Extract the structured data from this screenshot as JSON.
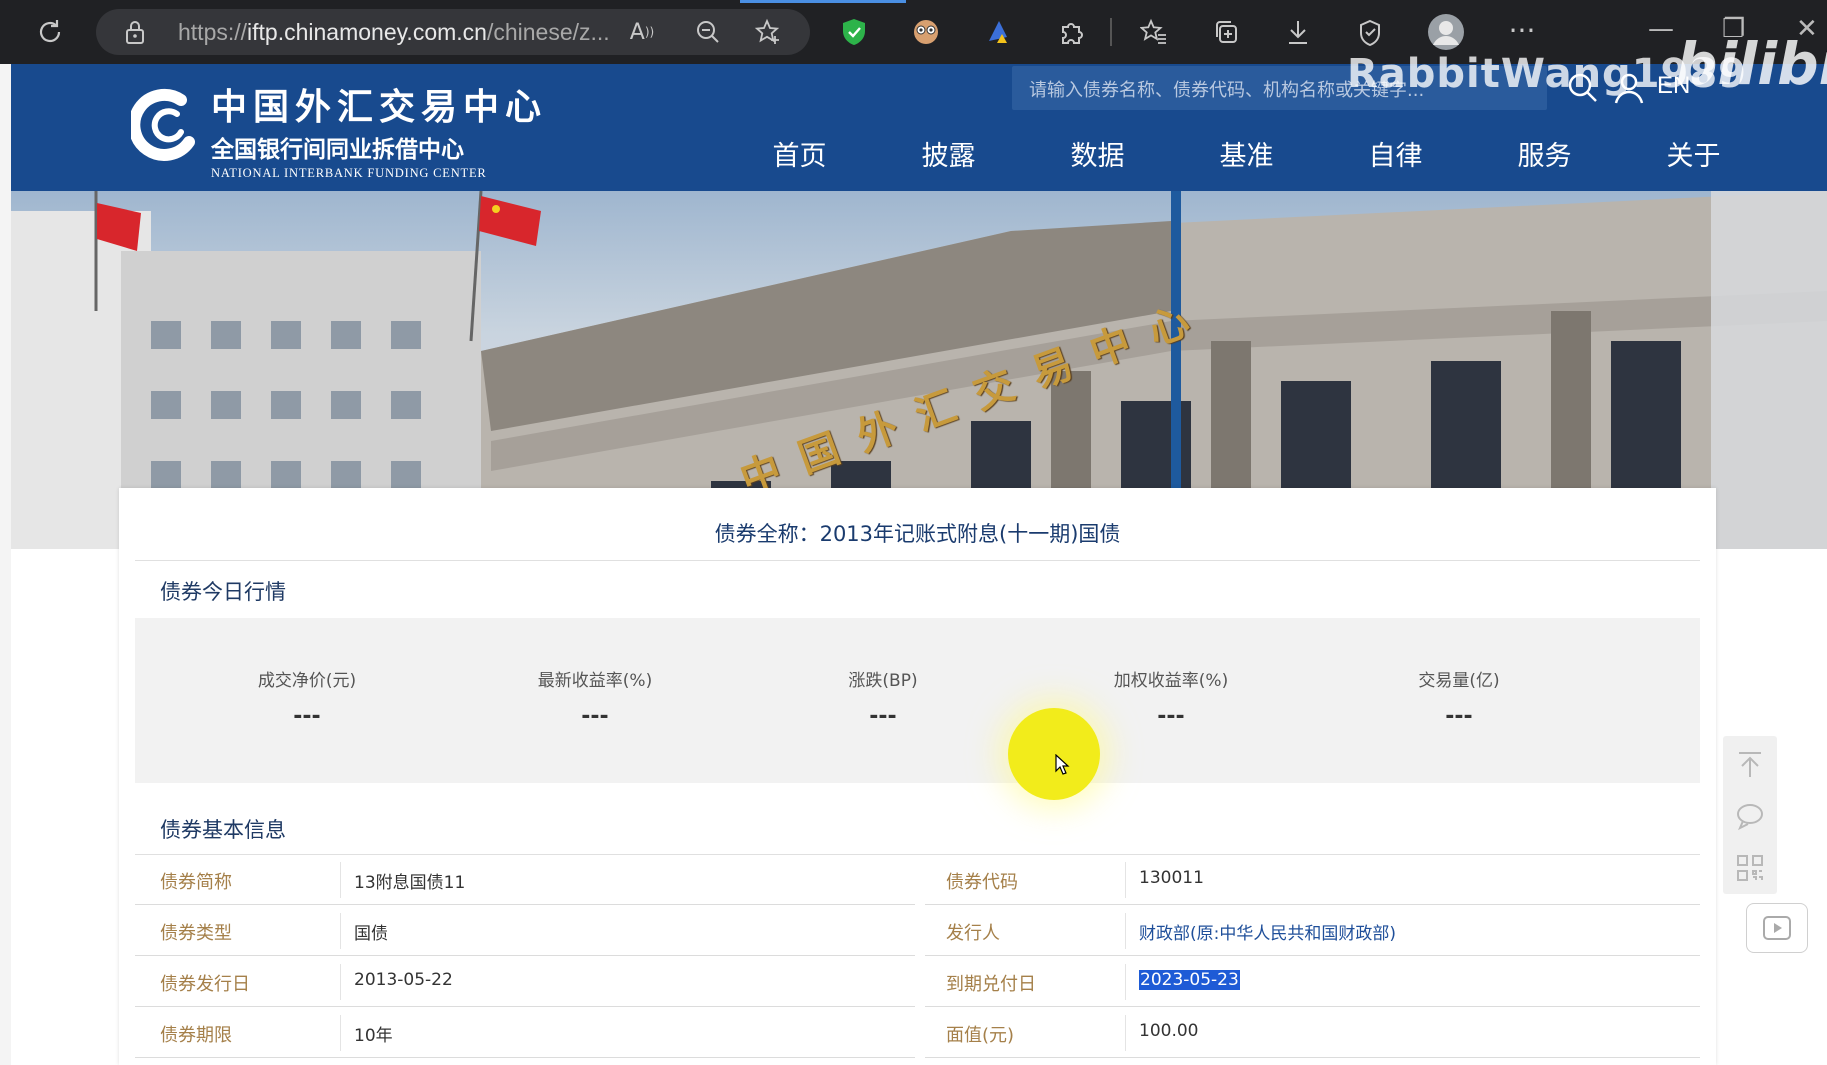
{
  "browser": {
    "url_prefix": "https://",
    "url_domain": "iftp.chinamoney.com.cn",
    "url_rest": "/chinese/z..."
  },
  "site": {
    "logo_cn_main": "中国外汇交易中心",
    "logo_cn_sub": "全国银行间同业拆借中心",
    "logo_en": "NATIONAL INTERBANK FUNDING CENTER",
    "search_placeholder": "请输入债券名称、债券代码、机构名称或关键字...",
    "lang": "EN",
    "watermark": "RabbitWang1989",
    "watermark_logo": "bilibili",
    "banner_sign": "中国外汇交易中心",
    "nav": [
      "首页",
      "披露",
      "数据",
      "基准",
      "自律",
      "服务",
      "关于"
    ]
  },
  "bond": {
    "full_name": "债券全称：2013年记账式附息(十一期)国债",
    "quote_title": "债券今日行情",
    "quotes": [
      {
        "label": "成交净价(元)",
        "value": "---"
      },
      {
        "label": "最新收益率(%)",
        "value": "---"
      },
      {
        "label": "涨跌(BP)",
        "value": "---"
      },
      {
        "label": "加权收益率(%)",
        "value": "---"
      },
      {
        "label": "交易量(亿)",
        "value": "---"
      }
    ],
    "info_title": "债券基本信息",
    "info_rows": [
      {
        "l1": "债券简称",
        "v1": "13附息国债11",
        "l2": "债券代码",
        "v2": "130011"
      },
      {
        "l1": "债券类型",
        "v1": "国债",
        "l2": "发行人",
        "v2": "财政部(原:中华人民共和国财政部)"
      },
      {
        "l1": "债券发行日",
        "v1": "2013-05-22",
        "l2": "到期兑付日",
        "v2": "2023-05-23"
      },
      {
        "l1": "债券期限",
        "v1": "10年",
        "l2": "面值(元)",
        "v2": "100.00"
      }
    ]
  },
  "colors": {
    "header_blue": "#184a8e",
    "label_gold": "#a5804a",
    "link_blue": "#1f4f9a",
    "selection": "#1e5bd6",
    "cursor_highlight": "#f2ec1b"
  }
}
